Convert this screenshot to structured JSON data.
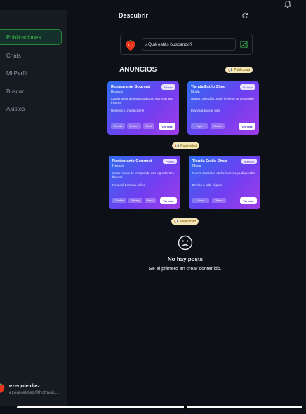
{
  "sidebar": {
    "items": [
      {
        "label": "Publicaciones",
        "icon": "home-icon",
        "active": true
      },
      {
        "label": "Chats",
        "icon": "chat-icon"
      },
      {
        "label": "Mi Perfil",
        "icon": "user-icon"
      },
      {
        "label": "Buscar",
        "icon": "search-icon"
      },
      {
        "label": "Ajustes",
        "icon": "settings-icon"
      }
    ],
    "user": {
      "name": "ezequieldiez",
      "email": "ezequieldiez@hotmail...."
    }
  },
  "header": {
    "title": "Descubrir",
    "refresh_icon": "refresh-icon"
  },
  "composer": {
    "placeholder": "¿Qué estás buscando?",
    "image_icon": "image-icon"
  },
  "ads": {
    "title": "ANUNCIOS",
    "badge": "Publicidad",
    "rows": [
      {
        "cards": [
          {
            "title": "Restaurante Gourmet",
            "subtitle": "Rosario",
            "tag": "Promo",
            "desc": "Carta nueva de temporada con ingredientes frescos",
            "desc2": "Reservá tu mesa online",
            "chips": [
              "Comida",
              "Delivery",
              "Menú"
            ],
            "button": "Ver más"
          },
          {
            "title": "Tienda Estilo Shop",
            "subtitle": "Moda",
            "tag": "Anuncio",
            "desc": "Nueva colección otoño invierno ya disponible",
            "desc2": "Envíos a todo el país",
            "chips": [
              "Ropa",
              "Ofertas"
            ],
            "button": "Ver más"
          }
        ]
      },
      {
        "cards": [
          {
            "title": "Restaurante Gourmet",
            "subtitle": "Rosario",
            "tag": "Promo",
            "desc": "Carta nueva de temporada con ingredientes frescos",
            "desc2": "Reservá tu mesa online",
            "chips": [
              "Comida",
              "Delivery",
              "Menú"
            ],
            "button": "Ver más"
          },
          {
            "title": "Tienda Estilo Shop",
            "subtitle": "Moda",
            "tag": "Anuncio",
            "desc": "Nueva colección otoño invierno ya disponible",
            "desc2": "Envíos a todo el país",
            "chips": [
              "Ropa",
              "Ofertas"
            ],
            "button": "Ver más"
          }
        ]
      }
    ],
    "between_badge": "Publicidad",
    "after_badge": "Publicidad"
  },
  "empty": {
    "title": "No hay posts",
    "subtitle": "Sé el primero en crear contenido.",
    "icon": "sad-face-icon"
  },
  "colors": {
    "accent": "#3fb950",
    "background": "#0d1117",
    "sidebar": "#161b22"
  }
}
